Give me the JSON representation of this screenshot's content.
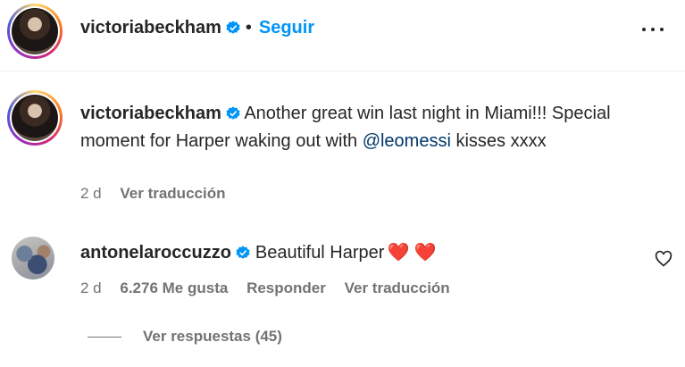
{
  "header": {
    "username": "victoriabeckham",
    "separator": "•",
    "follow_label": "Seguir",
    "more_icon": "more-horizontal-icon"
  },
  "caption": {
    "username": "victoriabeckham",
    "text_before": " Another great win last night in Miami!!! Special moment for Harper waking out with ",
    "mention": "@leomessi",
    "text_after": " kisses xxxx",
    "time": "2 d",
    "translate_label": "Ver traducción"
  },
  "comment": {
    "username": "antonelaroccuzzo",
    "text": "Beautiful Harper",
    "hearts": "❤️ ❤️",
    "time": "2 d",
    "likes": "6.276 Me gusta",
    "reply_label": "Responder",
    "translate_label": "Ver traducción",
    "like_icon": "heart-outline-icon"
  },
  "replies": {
    "label": "Ver respuestas (45)"
  },
  "colors": {
    "accent": "#0095f6",
    "mention": "#00376b",
    "muted": "#737373",
    "verified": "#0095f6"
  }
}
